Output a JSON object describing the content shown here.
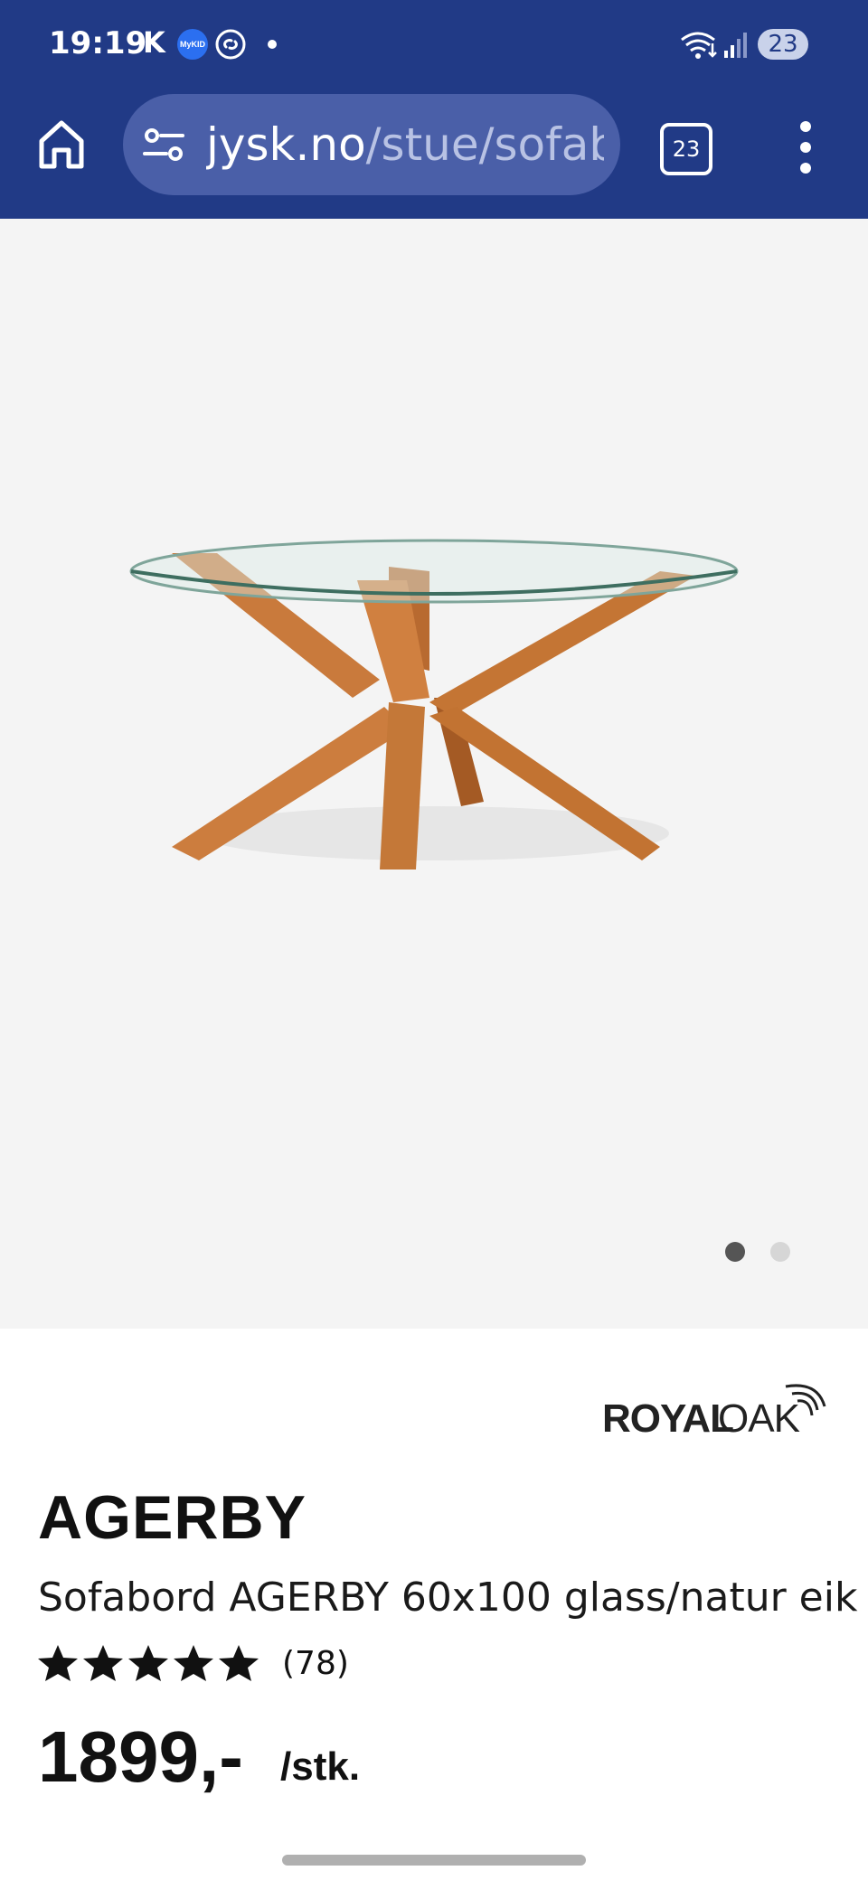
{
  "status_bar": {
    "time": "19:19",
    "carrier_letter": "K",
    "mykid_label": "MyKID",
    "battery": "23"
  },
  "browser": {
    "url_domain": "jysk.no",
    "url_path": "/stue/sofabord",
    "tab_count": "23"
  },
  "gallery": {
    "image_alt": "AGERBY coffee table with round glass top and oak legs",
    "page_indicator": {
      "current": 1,
      "total": 2
    }
  },
  "product": {
    "brand": "ROYAL OAK",
    "brand_part1": "ROYAL",
    "brand_part2": "OAK",
    "name": "AGERBY",
    "description": "Sofabord AGERBY 60x100 glass/natur eik",
    "rating": 5,
    "reviews": "(78)",
    "price": "1899,-",
    "unit": "/stk."
  },
  "colors": {
    "brand_blue": "#213a86",
    "url_pill": "#4a5fa8",
    "gallery_bg": "#f4f4f4"
  }
}
